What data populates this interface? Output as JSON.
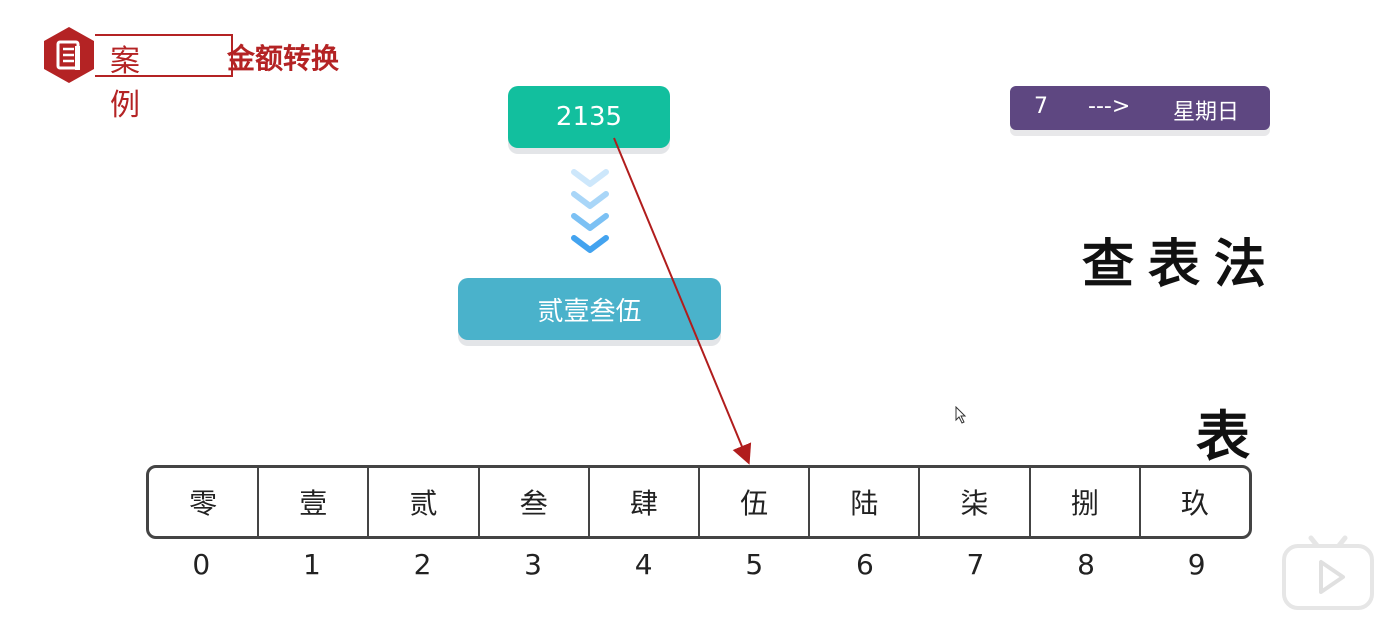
{
  "header": {
    "case_label": "案例",
    "title": "金额转换"
  },
  "input": {
    "value": "2135"
  },
  "output": {
    "value": "贰壹叁伍"
  },
  "example": {
    "number": "7",
    "arrow": "--->",
    "day": "星期日"
  },
  "method_label": "查表法",
  "table_label": "表",
  "table": {
    "cells": [
      "零",
      "壹",
      "贰",
      "叁",
      "肆",
      "伍",
      "陆",
      "柒",
      "捌",
      "玖"
    ],
    "indices": [
      "0",
      "1",
      "2",
      "3",
      "4",
      "5",
      "6",
      "7",
      "8",
      "9"
    ]
  },
  "colors": {
    "brand_red": "#b42324",
    "input_teal": "#12bf9e",
    "output_blue": "#4ab2cb",
    "example_purple": "#5e4781",
    "arrow_red": "#b11d1d"
  },
  "icons": [
    "document-icon",
    "chevron-down-icon",
    "cursor-icon",
    "play-icon"
  ]
}
